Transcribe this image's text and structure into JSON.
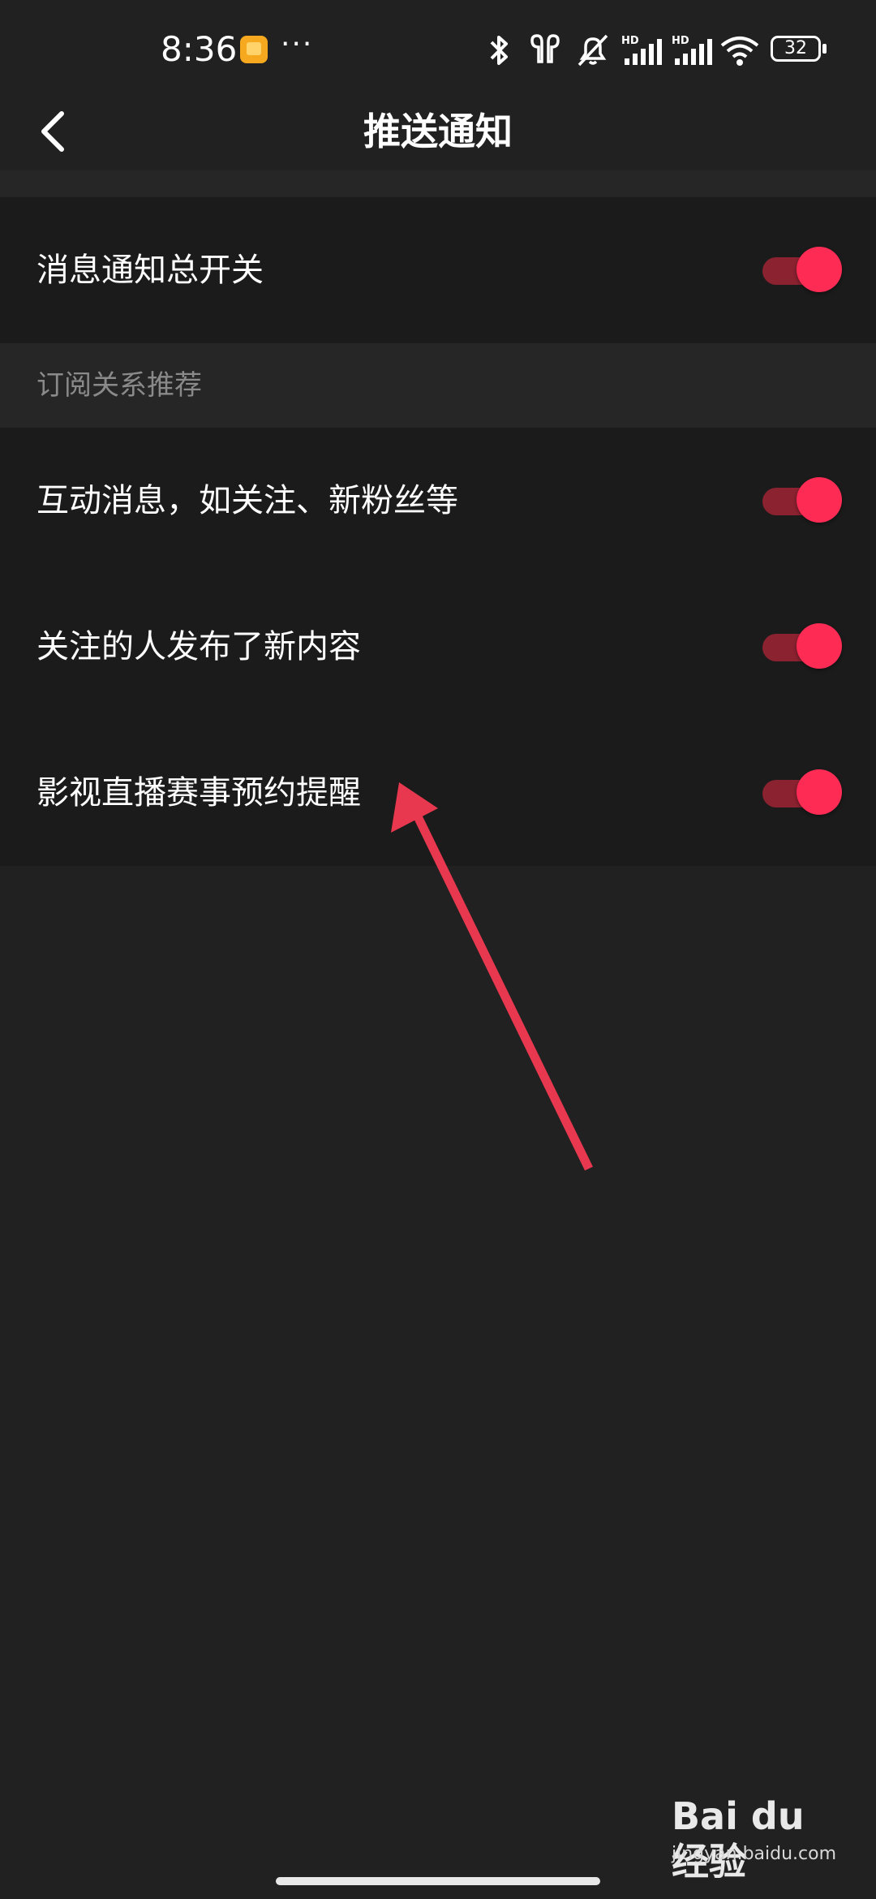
{
  "status_bar": {
    "time": "8:36",
    "more": "···",
    "battery": "32",
    "icons": [
      "notification-app-icon",
      "bluetooth-icon",
      "earbuds-icon",
      "mute-icon",
      "signal-hd-1-icon",
      "signal-hd-2-icon",
      "wifi-icon",
      "battery-icon"
    ]
  },
  "header": {
    "title": "推送通知",
    "back_icon": "chevron-left-icon"
  },
  "settings": {
    "master": {
      "label": "消息通知总开关",
      "enabled": true
    },
    "section_title": "订阅关系推荐",
    "items": [
      {
        "label": "互动消息，如关注、新粉丝等",
        "enabled": true
      },
      {
        "label": "关注的人发布了新内容",
        "enabled": true
      },
      {
        "label": "影视直播赛事预约提醒",
        "enabled": true
      }
    ]
  },
  "colors": {
    "accent": "#fe2c55",
    "toggle_track": "#8b2230",
    "background": "#212121",
    "card": "#1b1b1b",
    "annotation_arrow": "#e8384f"
  },
  "watermark": {
    "logo": "Bai du 经验",
    "url": "jingyan.baidu.com"
  }
}
